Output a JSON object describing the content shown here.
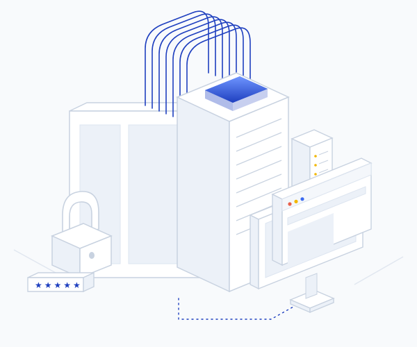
{
  "illustration": {
    "description": "Isometric 3D illustration depicting secure data infrastructure",
    "style": "isometric-outline",
    "palette": {
      "background": "#f8fafc",
      "line": "#c8d2e0",
      "line_dark": "#8fa2c0",
      "fill_light": "#ecf1f8",
      "fill_white": "#ffffff",
      "accent_blue": "#3a6af0",
      "accent_blue_dark": "#1e3fbf",
      "accent_yellow": "#f2b705",
      "accent_red": "#e85f4a",
      "accent_green": "#5cc97a"
    },
    "elements": {
      "main_panel": "large-document-panel",
      "server_tower": "server-rack",
      "server_slim": "secondary-server",
      "cables": "network-cables",
      "blue_port": "data-port-blue-glow",
      "monitor": "desktop-monitor",
      "browser": "browser-window",
      "padlock": "padlock",
      "password_strip": "masked-password-field",
      "connection": "dotted-network-line"
    },
    "password_mask": "★★★★★"
  }
}
